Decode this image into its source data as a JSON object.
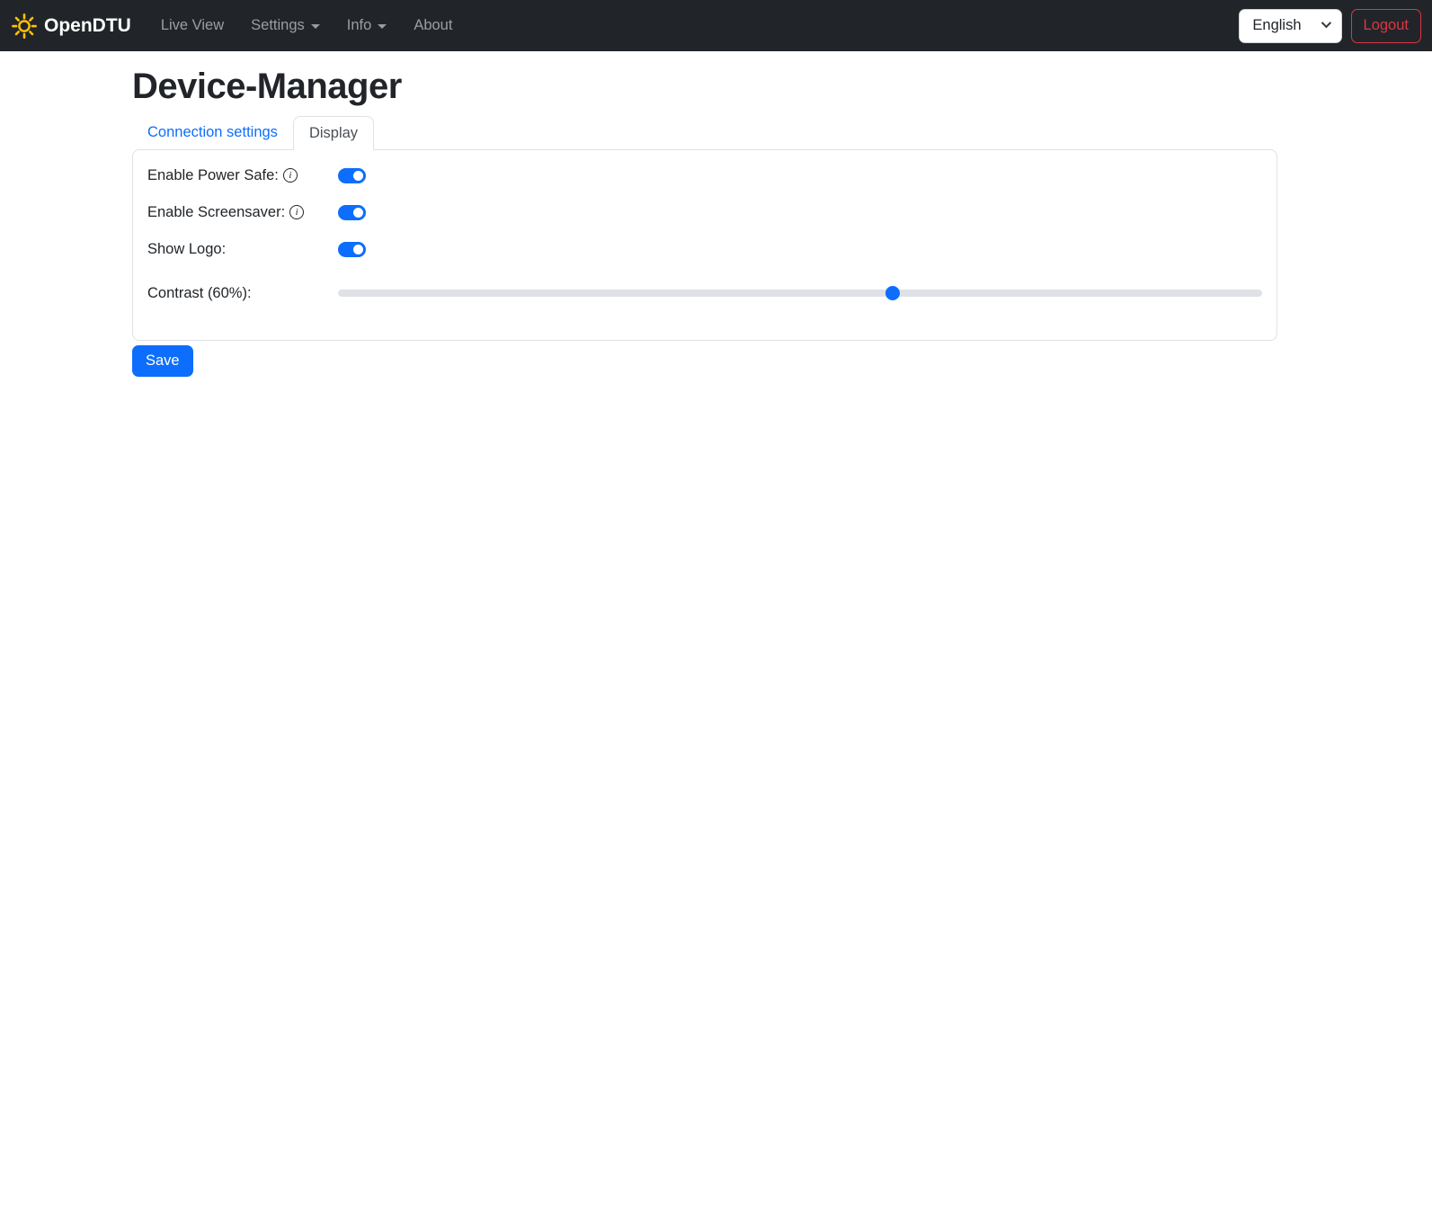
{
  "navbar": {
    "brand": "OpenDTU",
    "items": [
      {
        "label": "Live View",
        "dropdown": false
      },
      {
        "label": "Settings",
        "dropdown": true
      },
      {
        "label": "Info",
        "dropdown": true
      },
      {
        "label": "About",
        "dropdown": false
      }
    ],
    "language": "English",
    "logout_label": "Logout"
  },
  "page": {
    "title": "Device-Manager"
  },
  "tabs": [
    {
      "label": "Connection settings",
      "active": false
    },
    {
      "label": "Display",
      "active": true
    }
  ],
  "form": {
    "rows": [
      {
        "label": "Enable Power Safe:",
        "info": true,
        "type": "switch",
        "value": true
      },
      {
        "label": "Enable Screensaver:",
        "info": true,
        "type": "switch",
        "value": true
      },
      {
        "label": "Show Logo:",
        "info": false,
        "type": "switch",
        "value": true
      },
      {
        "label": "Contrast (60%):",
        "info": false,
        "type": "range",
        "value": 60
      }
    ],
    "save_label": "Save"
  },
  "icons": {
    "info_glyph": "i"
  },
  "colors": {
    "accent": "#0d6efd",
    "navbar_bg": "#212529",
    "danger": "#dc3545",
    "brand_icon": "#ffc107",
    "border": "#dee2e6"
  }
}
